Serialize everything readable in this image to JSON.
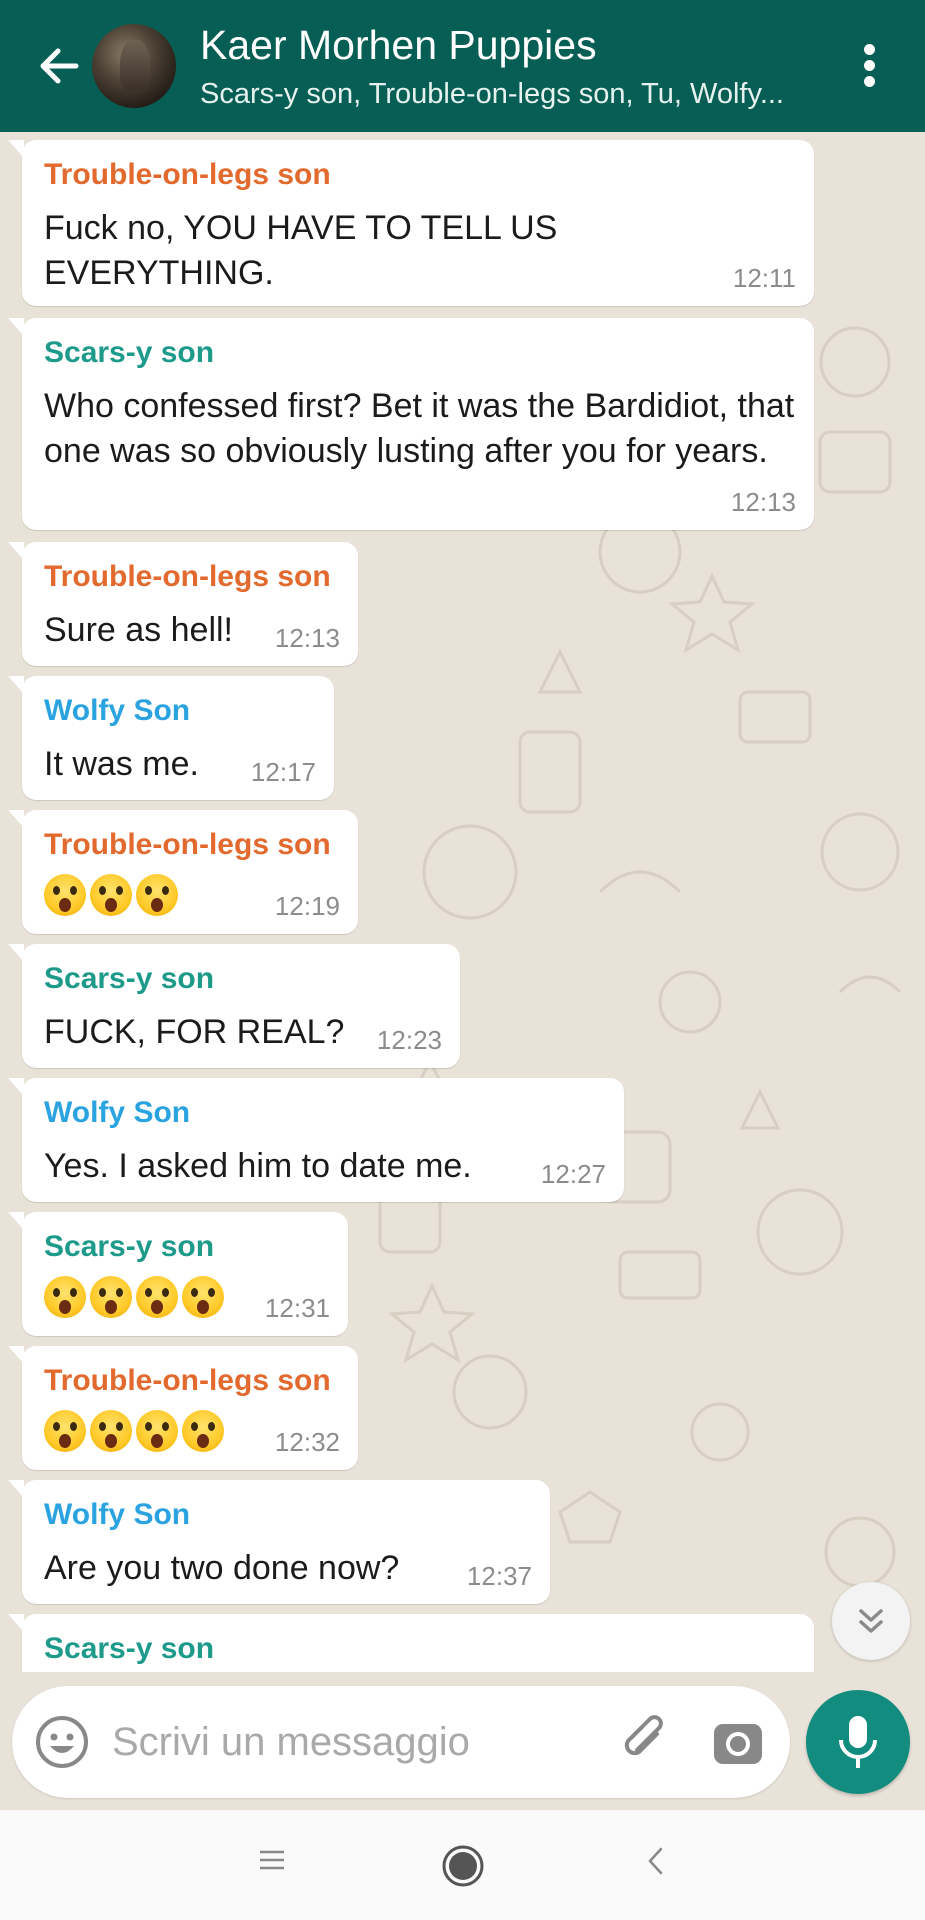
{
  "header": {
    "title": "Kaer Morhen Puppies",
    "subtitle": "Scars-y son, Trouble-on-legs son, Tu, Wolfy..."
  },
  "colors": {
    "header_bg": "#075e54",
    "trouble": "#e36a2e",
    "scars": "#1e9a8a",
    "wolfy": "#2aa3e0",
    "mic_bg": "#128c7e"
  },
  "messages": [
    {
      "sender": "Trouble-on-legs son",
      "text": "Fuck no, YOU HAVE TO TELL US EVERYTHING.",
      "time": "12:11"
    },
    {
      "sender": "Scars-y son",
      "text": "Who confessed first? Bet it was the Bardidiot, that one was so obviously lusting after you for years.",
      "time": "12:13"
    },
    {
      "sender": "Trouble-on-legs son",
      "text": "Sure as hell!",
      "time": "12:13"
    },
    {
      "sender": "Wolfy Son",
      "text": "It was me.",
      "time": "12:17"
    },
    {
      "sender": "Trouble-on-legs son",
      "emoji_count": 3,
      "emoji": "face-screaming-in-fear",
      "time": "12:19"
    },
    {
      "sender": "Scars-y son",
      "text": "FUCK, FOR REAL?",
      "time": "12:23"
    },
    {
      "sender": "Wolfy Son",
      "text": "Yes. I asked him to date me.",
      "time": "12:27"
    },
    {
      "sender": "Scars-y son",
      "emoji_count": 4,
      "emoji": "face-screaming-in-fear",
      "time": "12:31"
    },
    {
      "sender": "Trouble-on-legs son",
      "emoji_count": 4,
      "emoji": "face-screaming-in-fear",
      "time": "12:32"
    },
    {
      "sender": "Wolfy Son",
      "text": "Are you two done now?",
      "time": "12:37"
    },
    {
      "sender": "Scars-y son",
      "partial": true
    }
  ],
  "composer": {
    "placeholder": "Scrivi un messaggio"
  },
  "icons": {
    "back": "arrow-left-icon",
    "menu": "more-vertical-icon",
    "scroll": "double-chevron-down-icon",
    "emoji": "smiley-icon",
    "attach": "paperclip-icon",
    "camera": "camera-icon",
    "mic": "microphone-icon"
  }
}
